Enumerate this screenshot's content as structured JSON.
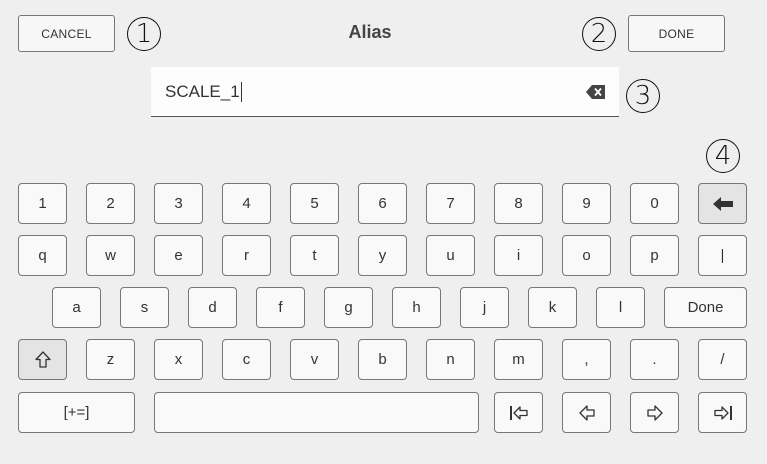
{
  "header": {
    "title": "Alias",
    "cancel_label": "CANCEL",
    "done_label": "DONE"
  },
  "input": {
    "value": "SCALE_1"
  },
  "callouts": [
    "1",
    "2",
    "3",
    "4"
  ],
  "keyboard": {
    "row1": [
      "1",
      "2",
      "3",
      "4",
      "5",
      "6",
      "7",
      "8",
      "9",
      "0"
    ],
    "row2": [
      "q",
      "w",
      "e",
      "r",
      "t",
      "y",
      "u",
      "i",
      "o",
      "p",
      "|"
    ],
    "row3": [
      "a",
      "s",
      "d",
      "f",
      "g",
      "h",
      "j",
      "k",
      "l"
    ],
    "row3_done": "Done",
    "row4": [
      "z",
      "x",
      "c",
      "v",
      "b",
      "n",
      "m",
      ",",
      ".",
      "/"
    ],
    "symbols_label": "[+=]"
  },
  "icons": {
    "backspace": "backspace-arrow-icon",
    "clear": "clear-text-icon",
    "shift": "shift-up-arrow-icon",
    "home": "cursor-home-icon",
    "left": "cursor-left-icon",
    "right": "cursor-right-icon",
    "end": "cursor-end-icon"
  },
  "colors": {
    "background": "#efefef",
    "key_fill": "#f9f9f9",
    "key_border": "#777777"
  }
}
